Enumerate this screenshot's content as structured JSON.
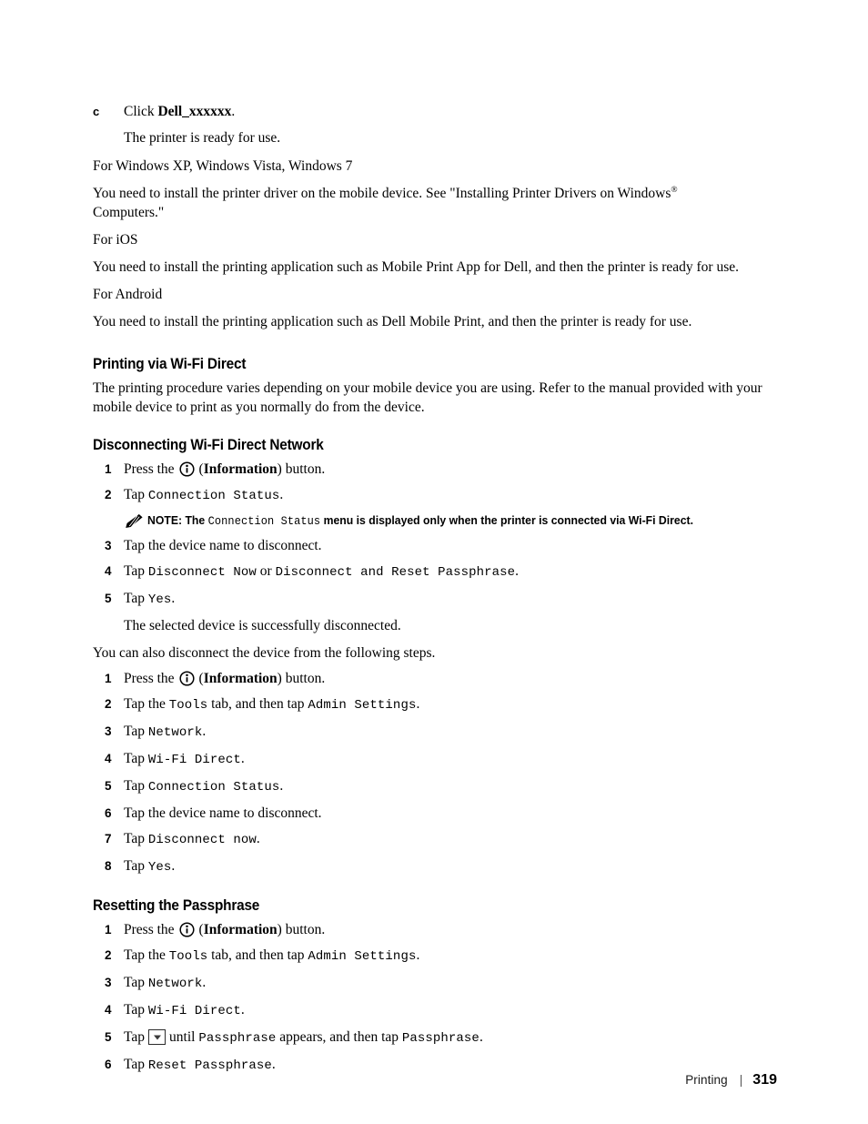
{
  "document": {
    "page_number": "319",
    "footer_label": "Printing",
    "footer_separator": "|"
  },
  "top_section": {
    "letter_step": {
      "marker": "c",
      "text_prefix": "Click ",
      "bold_text": "Dell_xxxxxx",
      "text_suffix": "."
    },
    "letter_step_note": "The printer is ready for use.",
    "windows_heading": "For Windows XP, Windows Vista, Windows 7",
    "windows_body_part1": "You need to install the printer driver on the mobile device. See \"Installing Printer Drivers on Windows",
    "windows_body_reg": "®",
    "windows_body_part2": "Computers.\"",
    "ios_heading": "For iOS",
    "ios_body": "You need to install the printing application such as Mobile Print App for Dell, and then the printer is ready for use.",
    "android_heading": "For Android",
    "android_body": "You need to install the printing application such as Dell Mobile Print, and then the printer is ready for use."
  },
  "printing_via_wifi_direct": {
    "heading": "Printing via Wi-Fi Direct",
    "body": "The printing procedure varies depending on your mobile device you are using. Refer to the manual provided with your mobile device to print as you normally do from the device."
  },
  "disconnecting": {
    "heading": "Disconnecting Wi-Fi Direct Network",
    "steps": [
      {
        "num": "1",
        "pre": "Press the",
        "icon": "information-icon",
        "paren_open": "(",
        "bold": "Information",
        "paren_close": ") button."
      },
      {
        "num": "2",
        "pre": "Tap ",
        "mono1": "Connection Status",
        "post": "."
      },
      {
        "num": "3",
        "pre": "Tap the device name to disconnect."
      },
      {
        "num": "4",
        "pre": "Tap ",
        "mono1": "Disconnect Now",
        "mid": " or ",
        "mono2": "Disconnect and Reset Passphrase",
        "post": "."
      },
      {
        "num": "5",
        "pre": "Tap ",
        "mono1": "Yes",
        "post": "."
      }
    ],
    "note": {
      "label": "NOTE:",
      "text_pre": " The ",
      "mono": "Connection Status",
      "text_post": " menu is displayed only when the printer is connected via Wi-Fi Direct."
    },
    "step5_result": "The selected device is successfully disconnected."
  },
  "alternate_disconnect": {
    "intro": "You can also disconnect the device from the following steps.",
    "steps": [
      {
        "num": "1",
        "pre": "Press the",
        "icon": "information-icon",
        "paren_open": "(",
        "bold": "Information",
        "paren_close": ") button."
      },
      {
        "num": "2",
        "pre": "Tap the ",
        "mono1": "Tools",
        "mid": " tab, and then tap ",
        "mono2": "Admin Settings",
        "post": "."
      },
      {
        "num": "3",
        "pre": "Tap ",
        "mono1": "Network",
        "post": "."
      },
      {
        "num": "4",
        "pre": "Tap ",
        "mono1": "Wi-Fi Direct",
        "post": "."
      },
      {
        "num": "5",
        "pre": "Tap ",
        "mono1": "Connection Status",
        "post": "."
      },
      {
        "num": "6",
        "pre": "Tap the device name to disconnect."
      },
      {
        "num": "7",
        "pre": "Tap ",
        "mono1": "Disconnect now",
        "post": "."
      },
      {
        "num": "8",
        "pre": "Tap ",
        "mono1": "Yes",
        "post": "."
      }
    ]
  },
  "resetting_passphrase": {
    "heading": "Resetting the Passphrase",
    "steps": [
      {
        "num": "1",
        "pre": "Press the",
        "icon": "information-icon",
        "paren_open": "(",
        "bold": "Information",
        "paren_close": ") button."
      },
      {
        "num": "2",
        "pre": "Tap the ",
        "mono1": "Tools",
        "mid": " tab, and then tap ",
        "mono2": "Admin Settings",
        "post": "."
      },
      {
        "num": "3",
        "pre": "Tap ",
        "mono1": "Network",
        "post": "."
      },
      {
        "num": "4",
        "pre": "Tap ",
        "mono1": "Wi-Fi Direct",
        "post": "."
      },
      {
        "num": "5",
        "pre": "Tap",
        "icon": "down-arrow-button-icon",
        "mid_pre": "until ",
        "mono1": "Passphrase",
        "mid": " appears, and then tap ",
        "mono2": "Passphrase",
        "post": "."
      },
      {
        "num": "6",
        "pre": "Tap ",
        "mono1": "Reset Passphrase",
        "post": "."
      }
    ]
  }
}
